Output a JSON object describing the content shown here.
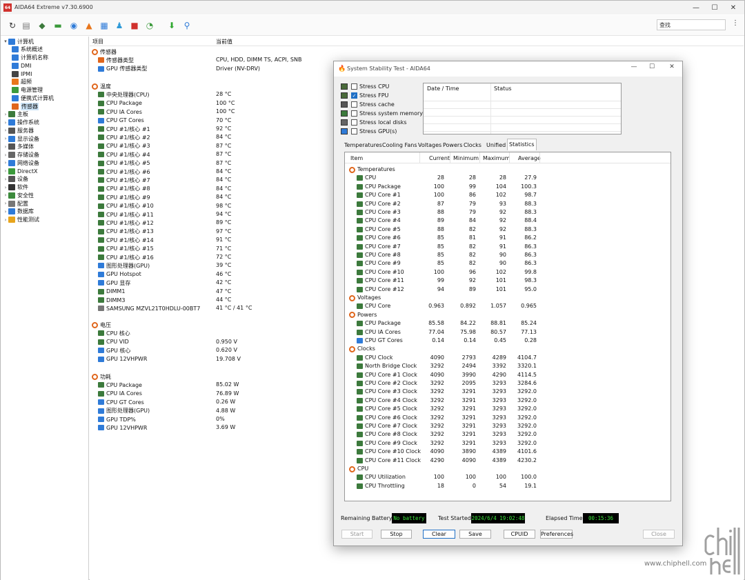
{
  "app": {
    "title": "AIDA64 Extreme v7.30.6900",
    "icon_text": "64"
  },
  "window_controls": {
    "minimize": "—",
    "maximize": "☐",
    "close": "✕"
  },
  "toolbar": {
    "icons": [
      "refresh-icon",
      "report-icon",
      "network-icon",
      "memory-icon",
      "motherboard-icon",
      "flame-icon",
      "benchmark-icon",
      "tools-icon",
      "osd-icon",
      "speedometer-icon",
      "download-icon",
      "search-icon"
    ],
    "search_text": "查找",
    "menu_glyph": "⋮"
  },
  "tree": {
    "items": [
      {
        "label": "计算机",
        "level": 0,
        "expander": "▾",
        "color": "#2f7bd8"
      },
      {
        "label": "系统概述",
        "level": 1,
        "color": "#2f7bd8"
      },
      {
        "label": "计算机名称",
        "level": 1,
        "color": "#2f7bd8"
      },
      {
        "label": "DMI",
        "level": 1,
        "color": "#2f7bd8"
      },
      {
        "label": "IPMI",
        "level": 1,
        "color": "#444444"
      },
      {
        "label": "超频",
        "level": 1,
        "color": "#e8761c"
      },
      {
        "label": "电源管理",
        "level": 1,
        "color": "#3c9a3c"
      },
      {
        "label": "便携式计算机",
        "level": 1,
        "color": "#2f7bd8"
      },
      {
        "label": "传感器",
        "level": 1,
        "color": "#e0661c",
        "selected": true
      },
      {
        "label": "主板",
        "level": 0,
        "expander": "›",
        "color": "#3c7a3c"
      },
      {
        "label": "操作系统",
        "level": 0,
        "expander": "›",
        "color": "#2f7bd8"
      },
      {
        "label": "服务器",
        "level": 0,
        "expander": "›",
        "color": "#555555"
      },
      {
        "label": "显示设备",
        "level": 0,
        "expander": "›",
        "color": "#2f7bd8"
      },
      {
        "label": "多媒体",
        "level": 0,
        "expander": "›",
        "color": "#555555"
      },
      {
        "label": "存储设备",
        "level": 0,
        "expander": "›",
        "color": "#666666"
      },
      {
        "label": "网络设备",
        "level": 0,
        "expander": "›",
        "color": "#2f7bd8"
      },
      {
        "label": "DirectX",
        "level": 0,
        "expander": "›",
        "color": "#3c9a3c"
      },
      {
        "label": "设备",
        "level": 0,
        "expander": "›",
        "color": "#555555"
      },
      {
        "label": "软件",
        "level": 0,
        "expander": "›",
        "color": "#333333"
      },
      {
        "label": "安全性",
        "level": 0,
        "expander": "›",
        "color": "#3c8a3c"
      },
      {
        "label": "配置",
        "level": 0,
        "expander": "›",
        "color": "#777777"
      },
      {
        "label": "数据库",
        "level": 0,
        "expander": "›",
        "color": "#2f7bd8"
      },
      {
        "label": "性能测试",
        "level": 0,
        "expander": "›",
        "color": "#e8a51c"
      }
    ]
  },
  "list": {
    "columns": [
      "项目",
      "当前值"
    ],
    "groups": [
      {
        "title": "传感器",
        "rows": [
          {
            "label": "传感器类型",
            "value": "CPU, HDD, DIMM TS, ACPI, SNB",
            "color": "#e0661c"
          },
          {
            "label": "GPU 传感器类型",
            "value": "Driver  (NV-DRV)",
            "color": "#2f7bd8"
          }
        ]
      },
      {
        "title": "温度",
        "rows": [
          {
            "label": "中央处理器(CPU)",
            "value": "28 °C",
            "color": "#3c7a3c"
          },
          {
            "label": "CPU Package",
            "value": "100 °C",
            "color": "#3c7a3c"
          },
          {
            "label": "CPU IA Cores",
            "value": "100 °C",
            "color": "#3c7a3c"
          },
          {
            "label": "CPU GT Cores",
            "value": "70 °C",
            "color": "#2f7bd8"
          },
          {
            "label": "CPU #1/核心 #1",
            "value": "92 °C",
            "color": "#3c7a3c"
          },
          {
            "label": "CPU #1/核心 #2",
            "value": "84 °C",
            "color": "#3c7a3c"
          },
          {
            "label": "CPU #1/核心 #3",
            "value": "87 °C",
            "color": "#3c7a3c"
          },
          {
            "label": "CPU #1/核心 #4",
            "value": "87 °C",
            "color": "#3c7a3c"
          },
          {
            "label": "CPU #1/核心 #5",
            "value": "87 °C",
            "color": "#3c7a3c"
          },
          {
            "label": "CPU #1/核心 #6",
            "value": "84 °C",
            "color": "#3c7a3c"
          },
          {
            "label": "CPU #1/核心 #7",
            "value": "84 °C",
            "color": "#3c7a3c"
          },
          {
            "label": "CPU #1/核心 #8",
            "value": "84 °C",
            "color": "#3c7a3c"
          },
          {
            "label": "CPU #1/核心 #9",
            "value": "84 °C",
            "color": "#3c7a3c"
          },
          {
            "label": "CPU #1/核心 #10",
            "value": "98 °C",
            "color": "#3c7a3c"
          },
          {
            "label": "CPU #1/核心 #11",
            "value": "94 °C",
            "color": "#3c7a3c"
          },
          {
            "label": "CPU #1/核心 #12",
            "value": "89 °C",
            "color": "#3c7a3c"
          },
          {
            "label": "CPU #1/核心 #13",
            "value": "97 °C",
            "color": "#3c7a3c"
          },
          {
            "label": "CPU #1/核心 #14",
            "value": "91 °C",
            "color": "#3c7a3c"
          },
          {
            "label": "CPU #1/核心 #15",
            "value": "71 °C",
            "color": "#3c7a3c"
          },
          {
            "label": "CPU #1/核心 #16",
            "value": "72 °C",
            "color": "#3c7a3c"
          },
          {
            "label": "图形处理器(GPU)",
            "value": "39 °C",
            "color": "#2f7bd8"
          },
          {
            "label": "GPU Hotspot",
            "value": "46 °C",
            "color": "#2f7bd8"
          },
          {
            "label": "GPU 显存",
            "value": "42 °C",
            "color": "#2f7bd8"
          },
          {
            "label": "DIMM1",
            "value": "47 °C",
            "color": "#3c7a3c"
          },
          {
            "label": "DIMM3",
            "value": "44 °C",
            "color": "#3c7a3c"
          },
          {
            "label": "SAMSUNG MZVL21T0HDLU-00BT7",
            "value": "41 °C / 41 °C",
            "color": "#777777"
          }
        ]
      },
      {
        "title": "电压",
        "rows": [
          {
            "label": "CPU 核心",
            "value": "",
            "color": "#3c7a3c"
          },
          {
            "label": "CPU VID",
            "value": "0.950 V",
            "color": "#3c7a3c"
          },
          {
            "label": "GPU 核心",
            "value": "0.620 V",
            "color": "#2f7bd8"
          },
          {
            "label": "GPU 12VHPWR",
            "value": "19.708 V",
            "color": "#2f7bd8"
          }
        ]
      },
      {
        "title": "功耗",
        "rows": [
          {
            "label": "CPU Package",
            "value": "85.02 W",
            "color": "#3c7a3c"
          },
          {
            "label": "CPU IA Cores",
            "value": "76.89 W",
            "color": "#3c7a3c"
          },
          {
            "label": "CPU GT Cores",
            "value": "0.26 W",
            "color": "#2f7bd8"
          },
          {
            "label": "图形处理器(GPU)",
            "value": "4.88 W",
            "color": "#2f7bd8"
          },
          {
            "label": "GPU TDP%",
            "value": "0%",
            "color": "#2f7bd8"
          },
          {
            "label": "GPU 12VHPWR",
            "value": "3.69 W",
            "color": "#2f7bd8"
          }
        ]
      }
    ]
  },
  "stability": {
    "title": "System Stability Test - AIDA64",
    "stress": [
      {
        "label": "Stress CPU",
        "checked": false
      },
      {
        "label": "Stress FPU",
        "checked": true
      },
      {
        "label": "Stress cache",
        "checked": false
      },
      {
        "label": "Stress system memory",
        "checked": false
      },
      {
        "label": "Stress local disks",
        "checked": false
      },
      {
        "label": "Stress GPU(s)",
        "checked": false
      }
    ],
    "log_columns": [
      "Date / Time",
      "Status"
    ],
    "tabs": [
      "Temperatures",
      "Cooling Fans",
      "Voltages",
      "Powers",
      "Clocks",
      "Unified",
      "Statistics"
    ],
    "active_tab": "Statistics",
    "stat_columns": [
      "Item",
      "Current",
      "Minimum",
      "Maximum",
      "Average"
    ],
    "stats": [
      {
        "cat": "Temperatures"
      },
      {
        "name": "CPU",
        "v": [
          "28",
          "28",
          "28",
          "27.9"
        ]
      },
      {
        "name": "CPU Package",
        "v": [
          "100",
          "99",
          "104",
          "100.3"
        ]
      },
      {
        "name": "CPU Core #1",
        "v": [
          "100",
          "86",
          "102",
          "98.7"
        ]
      },
      {
        "name": "CPU Core #2",
        "v": [
          "87",
          "79",
          "93",
          "88.3"
        ]
      },
      {
        "name": "CPU Core #3",
        "v": [
          "88",
          "79",
          "92",
          "88.3"
        ]
      },
      {
        "name": "CPU Core #4",
        "v": [
          "89",
          "84",
          "92",
          "88.4"
        ]
      },
      {
        "name": "CPU Core #5",
        "v": [
          "88",
          "82",
          "92",
          "88.3"
        ]
      },
      {
        "name": "CPU Core #6",
        "v": [
          "85",
          "81",
          "91",
          "86.2"
        ]
      },
      {
        "name": "CPU Core #7",
        "v": [
          "85",
          "82",
          "91",
          "86.3"
        ]
      },
      {
        "name": "CPU Core #8",
        "v": [
          "85",
          "82",
          "90",
          "86.3"
        ]
      },
      {
        "name": "CPU Core #9",
        "v": [
          "85",
          "82",
          "90",
          "86.3"
        ]
      },
      {
        "name": "CPU Core #10",
        "v": [
          "100",
          "96",
          "102",
          "99.8"
        ]
      },
      {
        "name": "CPU Core #11",
        "v": [
          "99",
          "92",
          "101",
          "98.3"
        ]
      },
      {
        "name": "CPU Core #12",
        "v": [
          "94",
          "89",
          "101",
          "95.0"
        ]
      },
      {
        "cat": "Voltages"
      },
      {
        "name": "CPU Core",
        "v": [
          "0.963",
          "0.892",
          "1.057",
          "0.965"
        ]
      },
      {
        "cat": "Powers"
      },
      {
        "name": "CPU Package",
        "v": [
          "85.58",
          "84.22",
          "88.81",
          "85.24"
        ]
      },
      {
        "name": "CPU IA Cores",
        "v": [
          "77.04",
          "75.98",
          "80.57",
          "77.13"
        ]
      },
      {
        "name": "CPU GT Cores",
        "v": [
          "0.14",
          "0.14",
          "0.45",
          "0.28"
        ]
      },
      {
        "cat": "Clocks"
      },
      {
        "name": "CPU Clock",
        "v": [
          "4090",
          "2793",
          "4289",
          "4104.7"
        ]
      },
      {
        "name": "North Bridge Clock",
        "v": [
          "3292",
          "2494",
          "3392",
          "3320.1"
        ]
      },
      {
        "name": "CPU Core #1 Clock",
        "v": [
          "4090",
          "3990",
          "4290",
          "4114.5"
        ]
      },
      {
        "name": "CPU Core #2 Clock",
        "v": [
          "3292",
          "2095",
          "3293",
          "3284.6"
        ]
      },
      {
        "name": "CPU Core #3 Clock",
        "v": [
          "3292",
          "3291",
          "3293",
          "3292.0"
        ]
      },
      {
        "name": "CPU Core #4 Clock",
        "v": [
          "3292",
          "3291",
          "3293",
          "3292.0"
        ]
      },
      {
        "name": "CPU Core #5 Clock",
        "v": [
          "3292",
          "3291",
          "3293",
          "3292.0"
        ]
      },
      {
        "name": "CPU Core #6 Clock",
        "v": [
          "3292",
          "3291",
          "3293",
          "3292.0"
        ]
      },
      {
        "name": "CPU Core #7 Clock",
        "v": [
          "3292",
          "3291",
          "3293",
          "3292.0"
        ]
      },
      {
        "name": "CPU Core #8 Clock",
        "v": [
          "3292",
          "3291",
          "3293",
          "3292.0"
        ]
      },
      {
        "name": "CPU Core #9 Clock",
        "v": [
          "3292",
          "3291",
          "3293",
          "3292.0"
        ]
      },
      {
        "name": "CPU Core #10 Clock",
        "v": [
          "4090",
          "3890",
          "4389",
          "4101.6"
        ]
      },
      {
        "name": "CPU Core #11 Clock",
        "v": [
          "4290",
          "4090",
          "4389",
          "4230.2"
        ]
      },
      {
        "cat": "CPU"
      },
      {
        "name": "CPU Utilization",
        "v": [
          "100",
          "100",
          "100",
          "100.0"
        ]
      },
      {
        "name": "CPU Throttling",
        "v": [
          "18",
          "0",
          "54",
          "19.1"
        ]
      }
    ],
    "remaining_battery_label": "Remaining Battery:",
    "remaining_battery_value": "No battery",
    "test_started_label": "Test Started:",
    "test_started_value": "2024/6/4 19:02:48",
    "elapsed_label": "Elapsed Time:",
    "elapsed_value": "00:15:36",
    "buttons": [
      "Start",
      "Stop",
      "Clear",
      "Save",
      "CPUID",
      "Preferences",
      "Close"
    ]
  },
  "watermark": {
    "logo_text": "chip hell",
    "url": "www.chiphell.com"
  }
}
